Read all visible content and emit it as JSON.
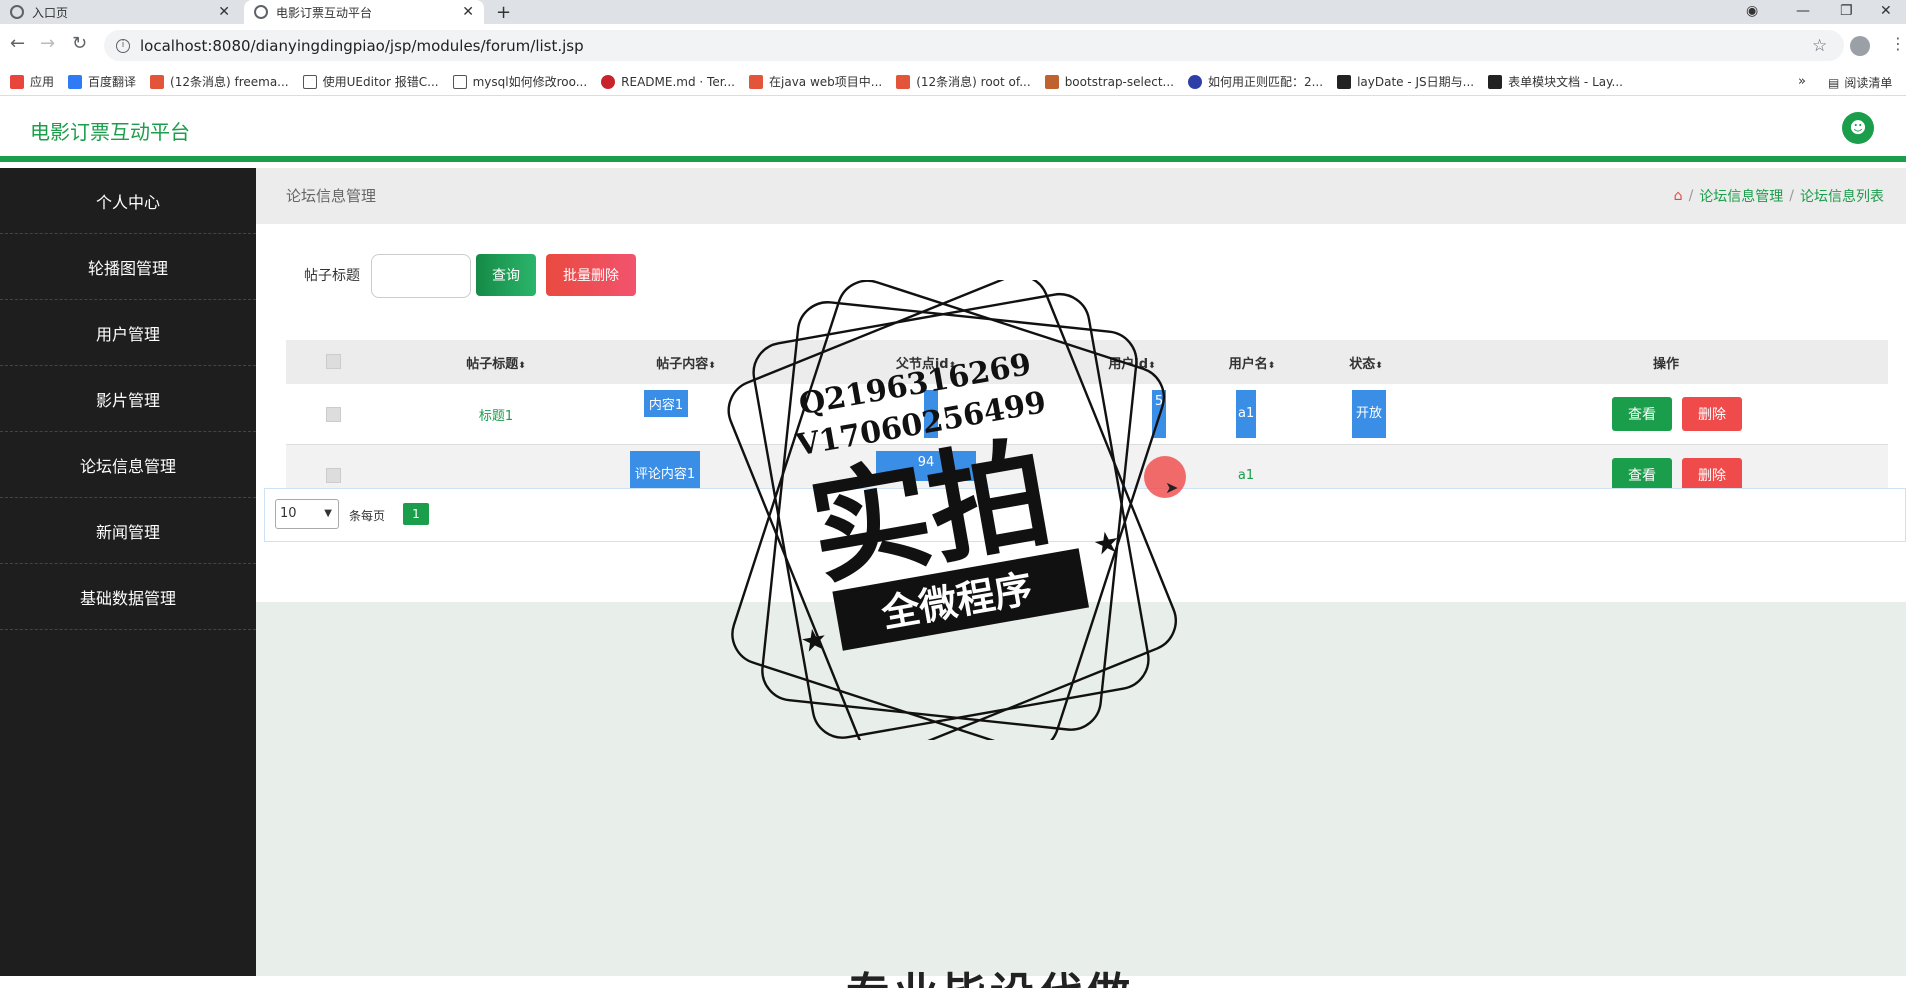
{
  "browser": {
    "tabs": [
      {
        "label": "入口页",
        "active": false
      },
      {
        "label": "电影订票互动平台",
        "active": true
      }
    ],
    "url": "localhost:8080/dianyingdingpiao/jsp/modules/forum/list.jsp",
    "bookmarks": [
      "应用",
      "百度翻译",
      "(12条消息) freema...",
      "使用UEditor 报错C...",
      "mysql如何修改roo...",
      "README.md · Ter...",
      "在java web项目中...",
      "(12条消息) root of...",
      "bootstrap-select...",
      "如何用正则匹配：2...",
      "layDate - JS日期与...",
      "表单模块文档 - Lay..."
    ],
    "more": "»",
    "reading_list": "阅读清单"
  },
  "app": {
    "brand": "电影订票互动平台",
    "sidebar": [
      "个人中心",
      "轮播图管理",
      "用户管理",
      "影片管理",
      "论坛信息管理",
      "新闻管理",
      "基础数据管理"
    ],
    "breadcrumb": {
      "title": "论坛信息管理",
      "path": [
        "论坛信息管理",
        "论坛信息列表"
      ]
    },
    "search": {
      "label": "帖子标题",
      "value": "",
      "query_button": "查询",
      "batch_delete_button": "批量删除"
    },
    "table": {
      "headers": [
        "帖子标题",
        "帖子内容",
        "父节点id",
        "用户id",
        "用户名",
        "状态",
        "操作"
      ],
      "rows": [
        {
          "title": "标题1",
          "content": "内容1",
          "parent_id": "",
          "user_id": "5",
          "username": "a1",
          "status": "开放"
        },
        {
          "title": "",
          "content": "评论内容1",
          "parent_id": "94",
          "user_id": "",
          "username": "a1",
          "status": ""
        }
      ],
      "view_label": "查看",
      "delete_label": "删除"
    },
    "pager": {
      "page_size": "10",
      "per_page_text": "条每页",
      "current_page": "1"
    },
    "bottom_text": "专业毕设代做"
  },
  "watermark": {
    "line1": "Q2196316269",
    "line2": "V17060256499",
    "big": "实拍",
    "banner": "全微程序"
  }
}
